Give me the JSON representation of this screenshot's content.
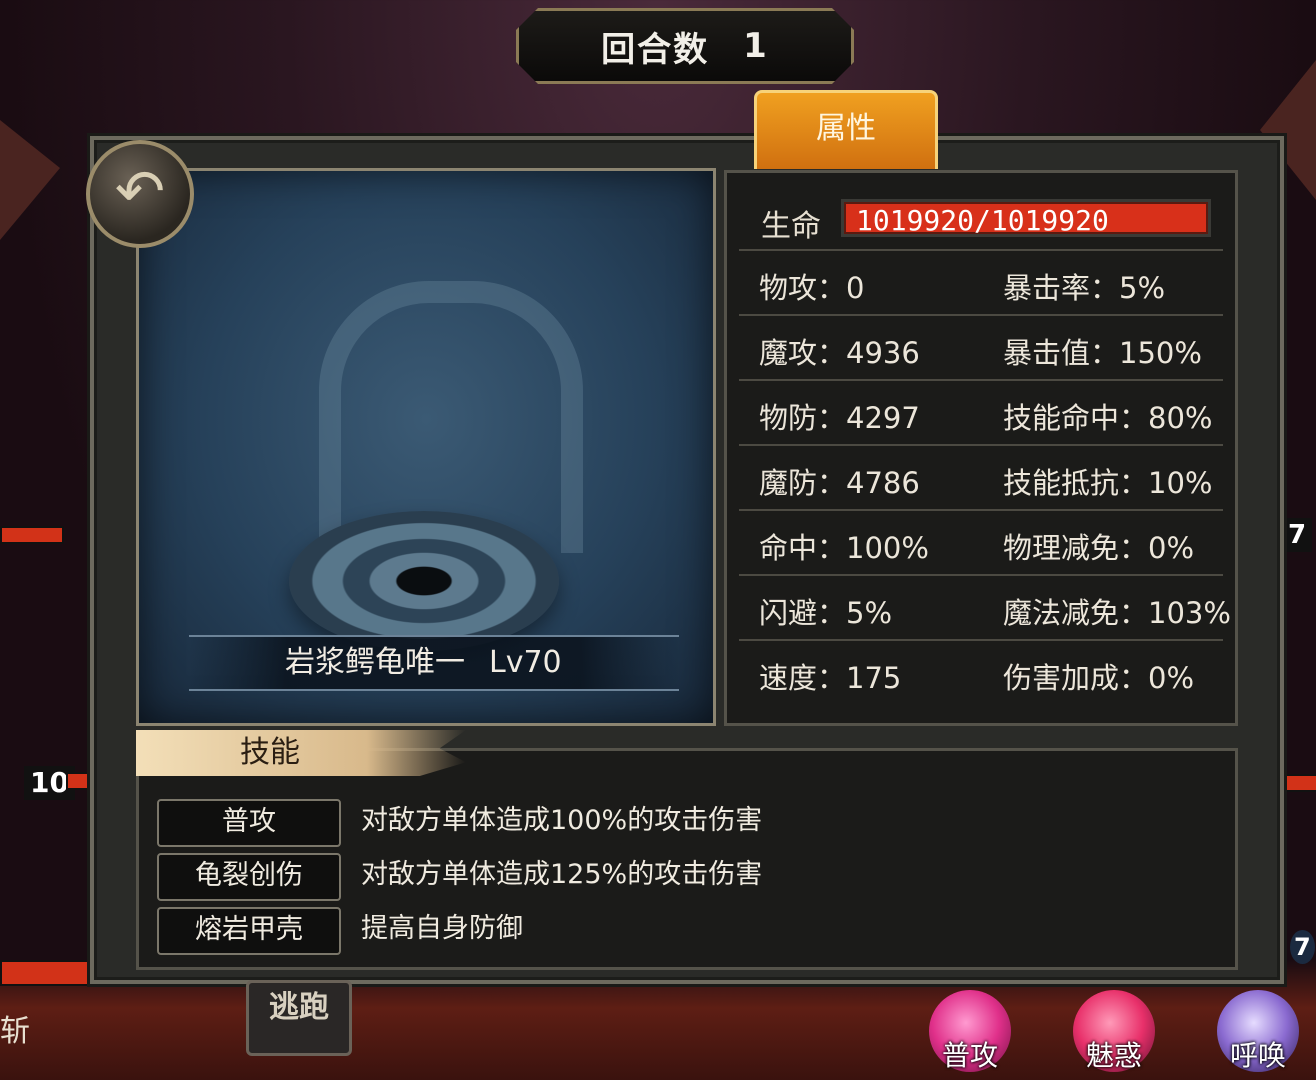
{
  "round": {
    "label": "回合数",
    "value": "1"
  },
  "tab": {
    "label": "属性"
  },
  "monster": {
    "name": "岩浆鳄龟唯一",
    "level": "Lv70"
  },
  "stats": {
    "hp_label": "生命",
    "hp_value": "1019920/1019920",
    "rows": [
      {
        "left": "物攻：0",
        "right": "暴击率：5%"
      },
      {
        "left": "魔攻：4936",
        "right": "暴击值：150%"
      },
      {
        "left": "物防：4297",
        "right": "技能命中：80%"
      },
      {
        "left": "魔防：4786",
        "right": "技能抵抗：10%"
      },
      {
        "left": "命中：100%",
        "right": "物理减免：0%"
      },
      {
        "left": "闪避：5%",
        "right": "魔法减免：103%"
      },
      {
        "left": "速度：175",
        "right": "伤害加成：0%"
      }
    ]
  },
  "skills": {
    "header": "技能",
    "items": [
      {
        "name": "普攻",
        "desc": "对敌方单体造成100%的攻击伤害"
      },
      {
        "name": "龟裂创伤",
        "desc": "对敌方单体造成125%的攻击伤害"
      },
      {
        "name": "熔岩甲壳",
        "desc": "提高自身防御"
      }
    ]
  },
  "background": {
    "flee_label": "逃跑",
    "left_word": "斩",
    "left_level": "10",
    "right_level_top": "7",
    "right_level_bottom": "7",
    "actions": [
      {
        "label": "普攻",
        "color": "#e0308a"
      },
      {
        "label": "魅惑",
        "color": "#e8306a"
      },
      {
        "label": "呼唤",
        "color": "#8a6ad0"
      }
    ]
  },
  "colors": {
    "tab": "#e88a18",
    "hp_bar": "#d8301a",
    "panel": "#2a2b28"
  }
}
